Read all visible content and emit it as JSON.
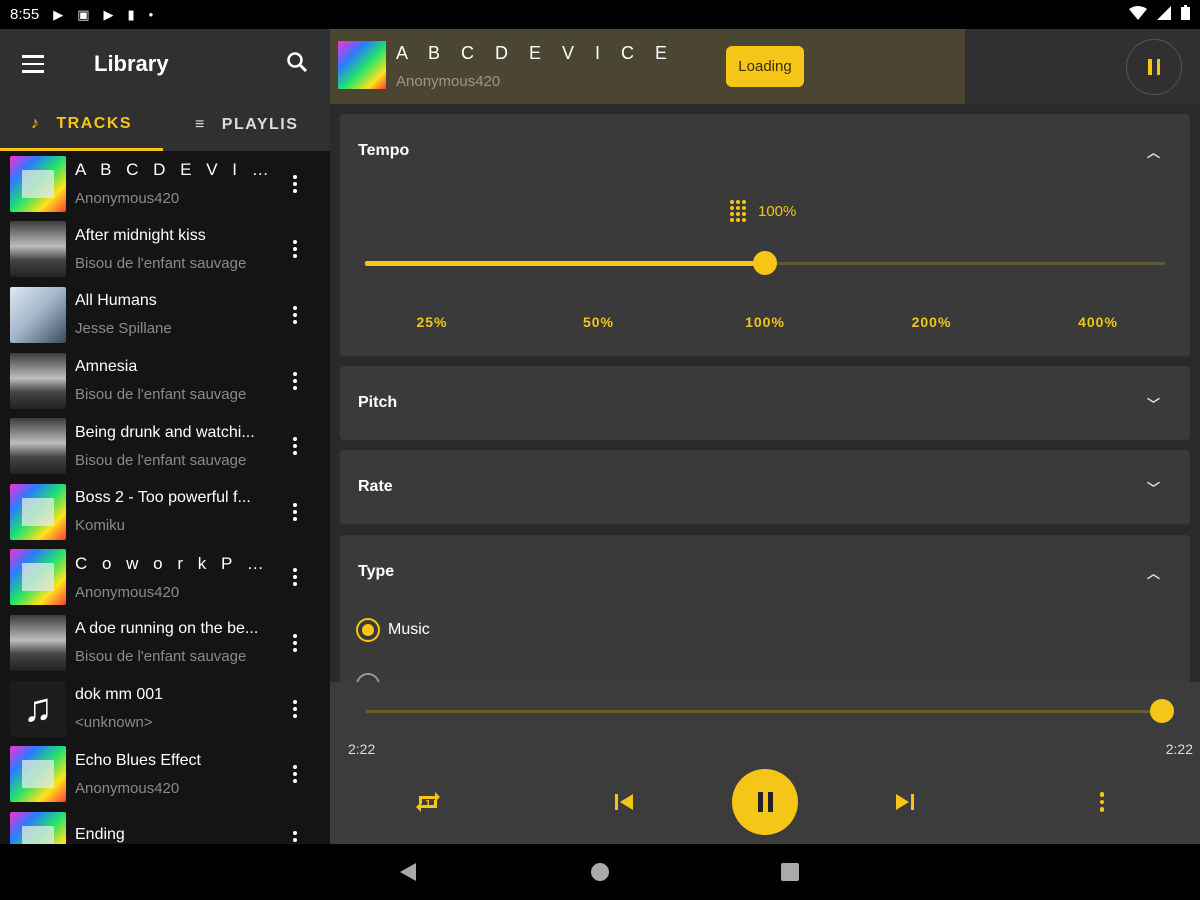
{
  "status": {
    "time": "8:55",
    "icons": [
      "play-icon",
      "notification-icon",
      "play-icon",
      "sd-card-icon",
      "dot-icon",
      "wifi-icon",
      "signal-icon",
      "battery-icon"
    ]
  },
  "library": {
    "title": "Library",
    "tabs": [
      {
        "label": "TRACKS",
        "icon": "music-note-icon",
        "active": true
      },
      {
        "label": "PLAYLIS",
        "icon": "playlist-icon",
        "active": false
      }
    ],
    "tracks": [
      {
        "title": "A B C D E V I C E",
        "artist": "Anonymous420",
        "art": "colorful",
        "spaced": true
      },
      {
        "title": "After midnight kiss",
        "artist": "Bisou de l'enfant sauvage",
        "art": "fog"
      },
      {
        "title": "All Humans",
        "artist": "Jesse Spillane",
        "art": "cover"
      },
      {
        "title": "Amnesia",
        "artist": "Bisou de l'enfant sauvage",
        "art": "fog"
      },
      {
        "title": "Being drunk and watchi...",
        "artist": "Bisou de l'enfant sauvage",
        "art": "fog"
      },
      {
        "title": "Boss 2 - Too powerful f...",
        "artist": "Komiku",
        "art": "colorful"
      },
      {
        "title": "C o w o r k  P a r t...",
        "artist": "Anonymous420",
        "art": "colorful",
        "spaced": true
      },
      {
        "title": "A doe running on the be...",
        "artist": "Bisou de l'enfant sauvage",
        "art": "fog"
      },
      {
        "title": "dok mm 001",
        "artist": "<unknown>",
        "art": "note"
      },
      {
        "title": "Echo Blues Effect",
        "artist": "Anonymous420",
        "art": "colorful"
      },
      {
        "title": "Ending",
        "artist": "",
        "art": "colorful"
      }
    ]
  },
  "now_playing": {
    "title": "A B C D E V I C E",
    "artist": "Anonymous420",
    "loading_label": "Loading"
  },
  "tempo": {
    "header": "Tempo",
    "value": "100%",
    "level": 0.5,
    "ticks": [
      "25%",
      "50%",
      "100%",
      "200%",
      "400%"
    ]
  },
  "pitch": {
    "header": "Pitch"
  },
  "rate": {
    "header": "Rate"
  },
  "type": {
    "header": "Type",
    "options": [
      {
        "label": "Music",
        "selected": true
      }
    ]
  },
  "player": {
    "elapsed": "2:22",
    "duration": "2:22",
    "progress": 1.0
  },
  "colors": {
    "accent": "#f5c518",
    "background": "#2a2a2a",
    "card": "#3a3a3a"
  }
}
